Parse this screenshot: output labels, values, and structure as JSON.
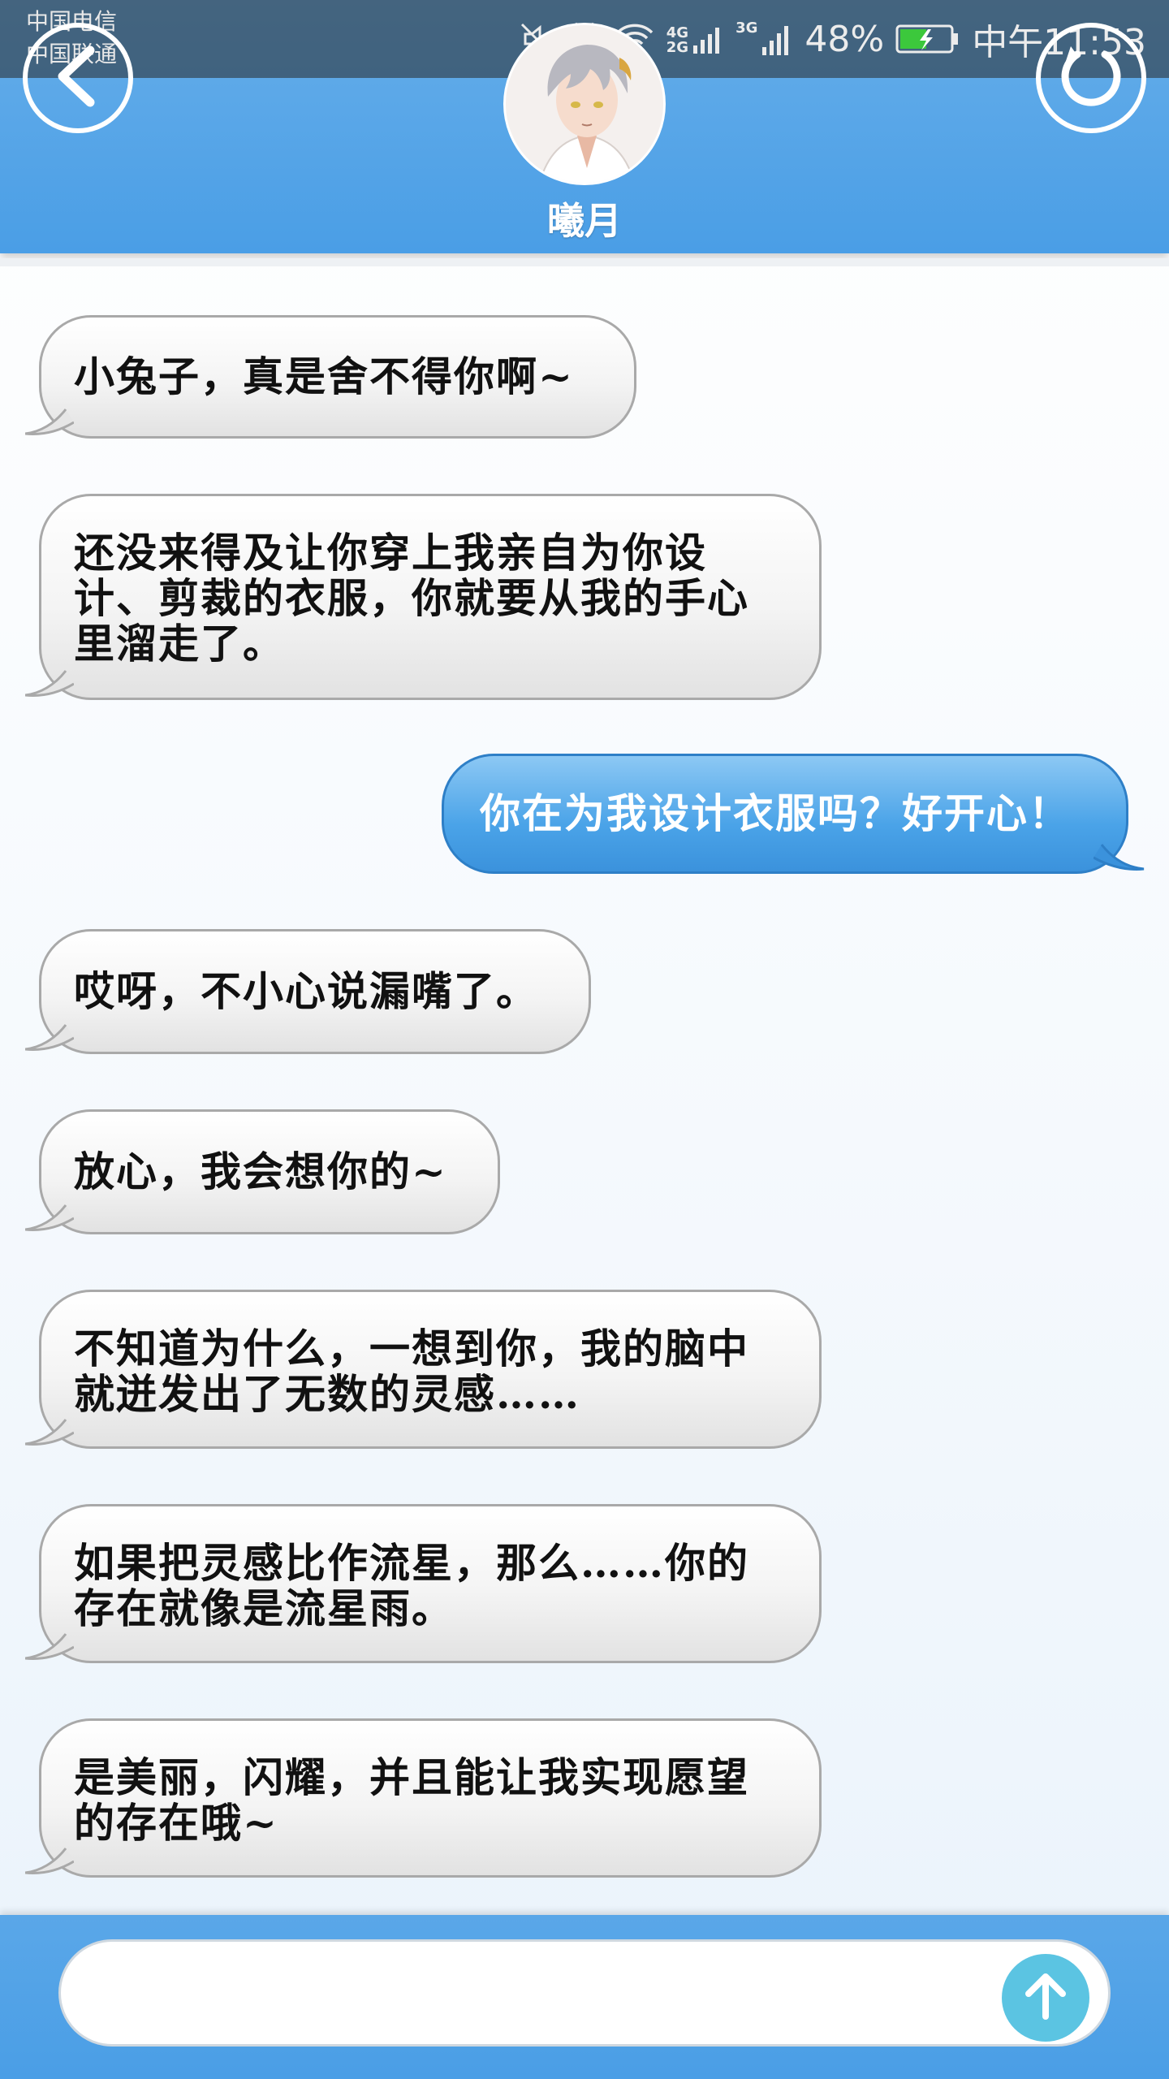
{
  "status_bar": {
    "carrier_1": "中国电信",
    "carrier_2": "中国联通",
    "network_1": "4G",
    "network_1b": "2G",
    "network_2": "3G",
    "battery": "48%",
    "time": "中午11:53"
  },
  "header": {
    "contact_name": "曦月"
  },
  "messages": [
    {
      "side": "incoming",
      "text": "小兔子，真是舍不得你啊~"
    },
    {
      "side": "incoming",
      "lines": [
        "还没来得及让你穿上我亲自为你设",
        "计、剪裁的衣服，你就要从我的手心",
        "里溜走了。"
      ]
    },
    {
      "side": "outgoing",
      "text": "你在为我设计衣服吗？好开心！"
    },
    {
      "side": "incoming",
      "text": "哎呀，不小心说漏嘴了。"
    },
    {
      "side": "incoming",
      "text": "放心，我会想你的~"
    },
    {
      "side": "incoming",
      "lines": [
        "不知道为什么，一想到你，我的脑中",
        "就迸发出了无数的灵感……"
      ]
    },
    {
      "side": "incoming",
      "lines": [
        "如果把灵感比作流星，那么……你的",
        "存在就像是流星雨。"
      ]
    },
    {
      "side": "incoming",
      "lines": [
        "是美丽，闪耀，并且能让我实现愿望",
        "的存在哦~"
      ]
    }
  ],
  "input": {
    "value": "",
    "placeholder": ""
  },
  "colors": {
    "header_blue": "#4a9ee6",
    "outgoing_bubble": "#4aa3e8",
    "send_button": "#5bc4e2"
  },
  "icons": {
    "back": "chevron-left-icon",
    "refresh": "refresh-icon",
    "send": "arrow-up-icon"
  }
}
